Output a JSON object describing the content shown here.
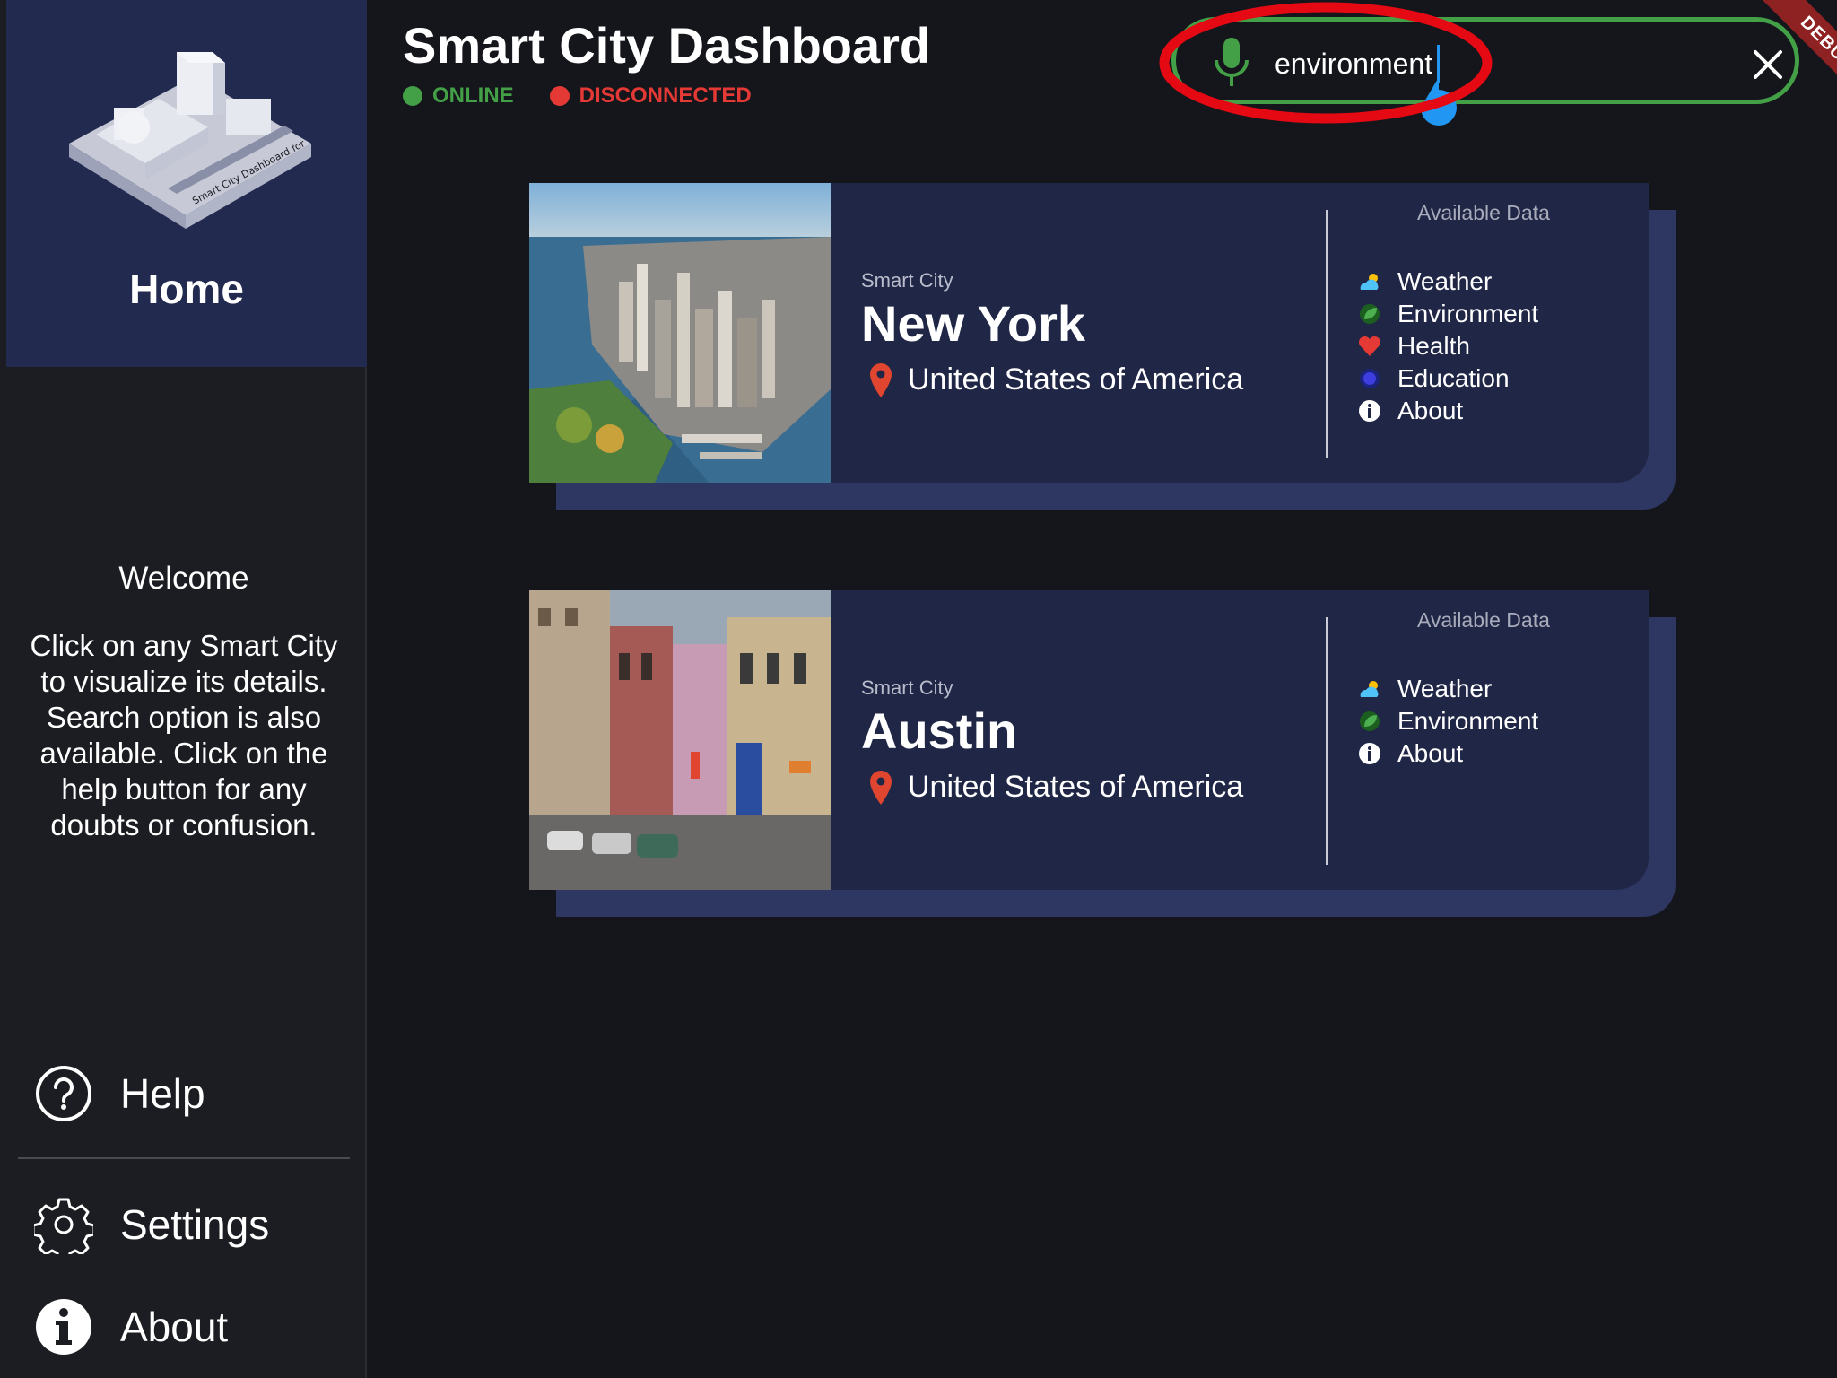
{
  "header": {
    "title": "Smart City Dashboard",
    "status_online": "ONLINE",
    "status_disconnected": "DISCONNECTED"
  },
  "search": {
    "value": "environment",
    "mic_icon": "microphone-icon",
    "clear_icon": "close-icon"
  },
  "debug_banner": "DEBUG",
  "sidebar": {
    "home_label": "Home",
    "welcome_title": "Welcome",
    "welcome_text": "Click on any Smart City to visualize its details. Search option is also available. Click on the help button for any doubts or confusion.",
    "items": [
      {
        "label": "Help",
        "icon": "help-icon"
      },
      {
        "label": "Settings",
        "icon": "gear-icon"
      },
      {
        "label": "About",
        "icon": "info-icon"
      }
    ]
  },
  "cities": [
    {
      "subtitle": "Smart City",
      "name": "New York",
      "country": "United States of America",
      "available_title": "Available Data",
      "data": [
        {
          "label": "Weather",
          "icon": "weather-icon"
        },
        {
          "label": "Environment",
          "icon": "leaf-icon"
        },
        {
          "label": "Health",
          "icon": "heart-icon"
        },
        {
          "label": "Education",
          "icon": "education-icon"
        },
        {
          "label": "About",
          "icon": "info-icon"
        }
      ]
    },
    {
      "subtitle": "Smart City",
      "name": "Austin",
      "country": "United States of America",
      "available_title": "Available Data",
      "data": [
        {
          "label": "Weather",
          "icon": "weather-icon"
        },
        {
          "label": "Environment",
          "icon": "leaf-icon"
        },
        {
          "label": "About",
          "icon": "info-icon"
        }
      ]
    }
  ],
  "colors": {
    "online": "#43a047",
    "disconnected": "#e53935",
    "card_bg": "#202646",
    "sidebar_header": "#222a4f",
    "annotation": "#e50914"
  }
}
